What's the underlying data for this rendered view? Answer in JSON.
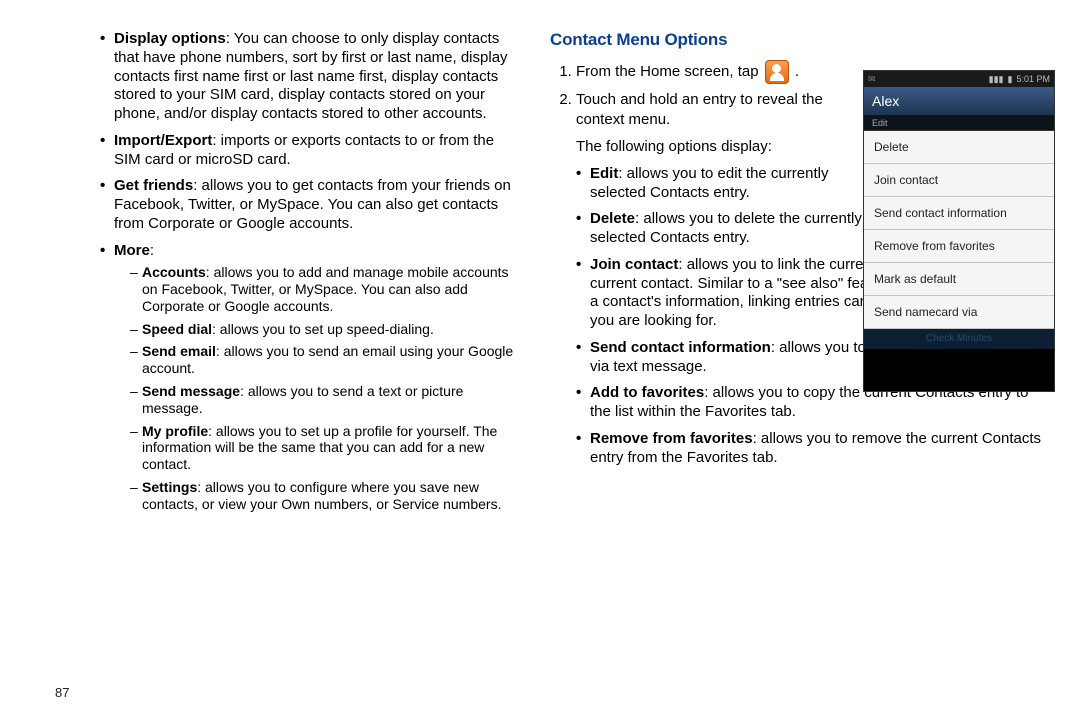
{
  "left": {
    "bullets": [
      {
        "bold": "Display options",
        "text": ": You can choose to only display contacts that have phone numbers, sort by first or last name, display contacts first name first or last name first, display contacts stored to your SIM card, display contacts stored on your phone, and/or display contacts stored to other accounts."
      },
      {
        "bold": "Import/Export",
        "text": ": imports or exports contacts to or from the SIM card or microSD card."
      },
      {
        "bold": "Get friends",
        "text": ": allows you to get contacts from your friends on Facebook, Twitter, or MySpace. You can also get contacts from Corporate or Google accounts."
      },
      {
        "bold": "More",
        "text": ":"
      }
    ],
    "more": [
      {
        "bold": "Accounts",
        "text": ": allows you to add and manage mobile accounts on Facebook, Twitter, or MySpace. You can also add Corporate or Google accounts."
      },
      {
        "bold": "Speed dial",
        "text": ": allows you to set up speed-dialing."
      },
      {
        "bold": "Send email",
        "text": ": allows you to send an email using your Google account."
      },
      {
        "bold": "Send message",
        "text": ": allows you to send a text or picture message."
      },
      {
        "bold": "My profile",
        "text": ": allows you to set up a profile for yourself. The information will be the same that you can add for a new contact."
      },
      {
        "bold": "Settings",
        "text": ": allows you to configure where you save new contacts, or view your Own numbers, or Service numbers."
      }
    ]
  },
  "right": {
    "heading": "Contact Menu Options",
    "step1a": "From the Home screen, tap ",
    "step1b": " .",
    "step2": "Touch and hold an entry to reveal the context menu.",
    "following": "The following options display:",
    "options": [
      {
        "bold": "Edit",
        "text": ": allows you to edit the currently selected Contacts entry."
      },
      {
        "bold": "Delete",
        "text": ": allows you to delete the currently selected Contacts entry."
      },
      {
        "bold": "Join contact",
        "text": ": allows you to link the current contact to another current contact. Similar to a \"see also\" feature. If you can't remember a contact's information, linking entries can help you find the person you are looking for."
      },
      {
        "bold": "Send contact information",
        "text": ": allows you to send the current entry info via text message."
      },
      {
        "bold": "Add to favorites",
        "text": ": allows you to copy the current Contacts entry to the list within the Favorites tab."
      },
      {
        "bold": "Remove from favorites",
        "text": ": allows you to remove the current Contacts entry from the Favorites tab."
      }
    ]
  },
  "phone": {
    "time": "5:01 PM",
    "signal": "▮▮▮",
    "contact": "Alex",
    "strip": "Edit",
    "menu": [
      "Delete",
      "Join contact",
      "Send contact information",
      "Remove from favorites",
      "Mark as default",
      "Send namecard via"
    ],
    "footer": "Check Minutes"
  },
  "pagenum": "87"
}
